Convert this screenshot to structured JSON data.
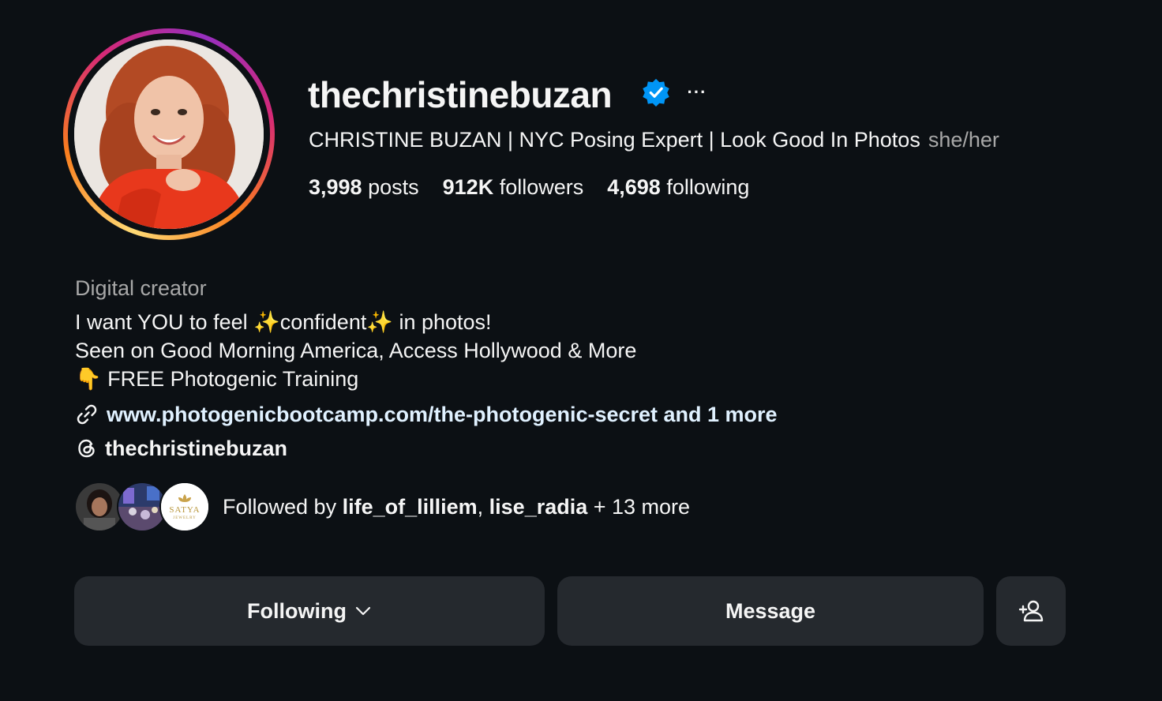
{
  "profile": {
    "username": "thechristinebuzan",
    "verified": true,
    "more_label": "···",
    "full_name": "CHRISTINE BUZAN | NYC Posing Expert | Look Good In Photos",
    "pronouns": "she/her"
  },
  "stats": {
    "posts_count": "3,998",
    "posts_label": "posts",
    "followers_count": "912K",
    "followers_label": "followers",
    "following_count": "4,698",
    "following_label": "following"
  },
  "bio": {
    "category": "Digital creator",
    "line1_a": "I want YOU to feel ",
    "line1_sparkle1": "✨",
    "line1_b": "confident",
    "line1_sparkle2": "✨",
    "line1_c": " in photos!",
    "line2": "Seen on Good Morning America, Access Hollywood & More",
    "line3_emoji": "👇",
    "line3_text": " FREE Photogenic Training",
    "link_text": "www.photogenicbootcamp.com/the-photogenic-secret and 1 more",
    "threads_handle": "thechristinebuzan"
  },
  "followed_by": {
    "prefix": "Followed by ",
    "user1": "life_of_lilliem",
    "sep": ", ",
    "user2": "lise_radia",
    "suffix": " + 13 more",
    "brand_avatar_text": "SATYA",
    "brand_avatar_sub": "JEWELRY"
  },
  "actions": {
    "following_label": "Following",
    "message_label": "Message"
  },
  "colors": {
    "background": "#0c1014",
    "button_bg": "#25292e",
    "verified_blue": "#0095f6",
    "secondary_text": "#a8a8a8"
  },
  "icons": [
    "verified-badge-icon",
    "more-options-icon",
    "link-icon",
    "threads-icon",
    "chevron-down-icon",
    "add-user-icon"
  ]
}
